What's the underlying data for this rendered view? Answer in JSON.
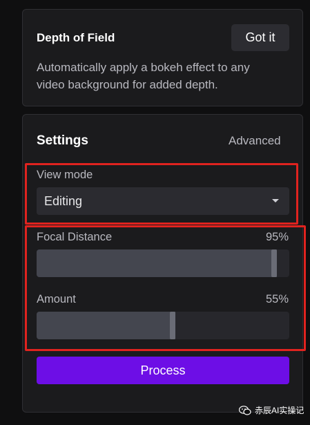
{
  "depth_of_field": {
    "title": "Depth of Field",
    "got_it_label": "Got it",
    "description": "Automatically apply a bokeh effect to any video background for added depth."
  },
  "settings": {
    "title": "Settings",
    "advanced_label": "Advanced",
    "view_mode": {
      "label": "View mode",
      "selected": "Editing"
    },
    "focal_distance": {
      "label": "Focal Distance",
      "value_text": "95%",
      "value": 0.95
    },
    "amount": {
      "label": "Amount",
      "value_text": "55%",
      "value": 0.55
    },
    "process_label": "Process"
  },
  "watermark": {
    "text": "赤辰AI实操记",
    "icon": "wechat-icon"
  },
  "colors": {
    "accent": "#6d0ee6",
    "highlight": "#e0231f"
  }
}
